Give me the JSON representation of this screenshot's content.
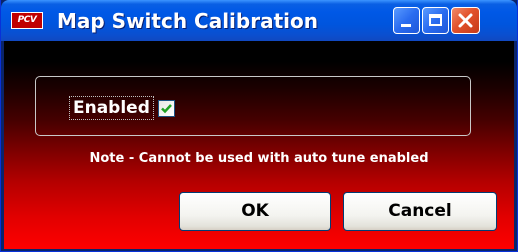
{
  "window": {
    "title": "Map Switch Calibration",
    "app_icon_text": "PCV",
    "icon": "pcv-app-icon"
  },
  "titlebar_buttons": {
    "minimize_icon": "minimize-icon",
    "maximize_icon": "maximize-icon",
    "close_icon": "close-icon"
  },
  "settings": {
    "enabled_label": "Enabled",
    "enabled_checked": true
  },
  "note": "Note - Cannot be used with auto tune enabled",
  "buttons": {
    "ok_label": "OK",
    "cancel_label": "Cancel"
  },
  "colors": {
    "titlebar": "#0055de",
    "close_button": "#e2522c",
    "background_top": "#000000",
    "background_bottom": "#ff0000",
    "checkmark": "#21a121"
  }
}
